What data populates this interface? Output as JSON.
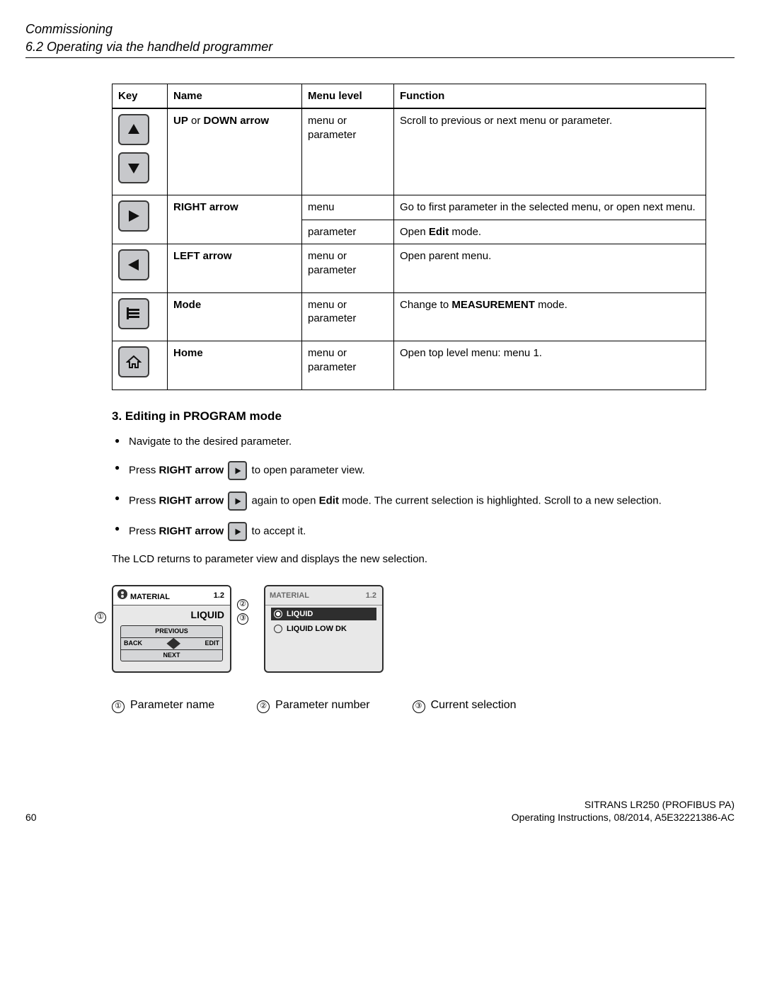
{
  "header": {
    "title": "Commissioning",
    "subtitle": "6.2 Operating via the handheld programmer"
  },
  "table": {
    "headers": {
      "key": "Key",
      "name": "Name",
      "level": "Menu level",
      "func": "Function"
    },
    "rows": {
      "updown": {
        "name_pre": "UP",
        "name_mid": " or ",
        "name_post": "DOWN arrow",
        "level": "menu or parameter",
        "func": "Scroll to previous or next menu or parameter."
      },
      "right": {
        "name": "RIGHT arrow",
        "level1": "menu",
        "func1": "Go to first parameter in the selected menu, or open next menu.",
        "level2": "parameter",
        "func2_pre": "Open ",
        "func2_b": "Edit",
        "func2_post": " mode."
      },
      "left": {
        "name": "LEFT arrow",
        "level": "menu or parameter",
        "func": "Open parent menu."
      },
      "mode": {
        "name": "Mode",
        "level": "menu or parameter",
        "func_pre": "Change to ",
        "func_b": "MEASUREMENT",
        "func_post": " mode."
      },
      "home": {
        "name": "Home",
        "level": "menu or parameter",
        "func": "Open top level menu: menu 1."
      }
    }
  },
  "section": {
    "heading": "3. Editing in PROGRAM mode",
    "b1": "Navigate to the desired parameter.",
    "b2_pre": "Press ",
    "b2_b": "RIGHT arrow",
    "b2_post": " to open parameter view.",
    "b3_pre": "Press ",
    "b3_b": "RIGHT arrow",
    "b3_mid": " again to open ",
    "b3_b2": "Edit",
    "b3_post": " mode. The current selection is highlighted. Scroll to a new selection.",
    "b4_pre": "Press ",
    "b4_b": "RIGHT arrow",
    "b4_post": " to accept it.",
    "tail": "The LCD returns to parameter view and displays the new selection."
  },
  "lcd": {
    "title": "MATERIAL",
    "num": "1.2",
    "value": "LIQUID",
    "nav": {
      "prev": "PREVIOUS",
      "back": "BACK",
      "edit": "EDIT",
      "next": "NEXT"
    },
    "opt1": "LIQUID",
    "opt2": "LIQUID LOW DK"
  },
  "legend": {
    "l1": "Parameter name",
    "l2": "Parameter number",
    "l3": "Current selection"
  },
  "footer": {
    "page": "60",
    "r1": "SITRANS LR250 (PROFIBUS PA)",
    "r2": "Operating Instructions, 08/2014, A5E32221386-AC"
  }
}
